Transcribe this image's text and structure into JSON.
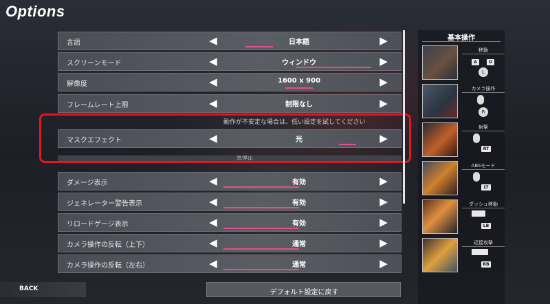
{
  "title": "Options",
  "note": "動作が不安定な場合は、低い設定を試してください",
  "partial_row_text": "急停止",
  "settings": [
    {
      "label": "言語",
      "value": "日本語",
      "level": 0.15
    },
    {
      "label": "スクリーンモード",
      "value": "ウィンドウ",
      "level": 0.7
    },
    {
      "label": "解像度",
      "value": "1600 x 900",
      "level": 0.4
    },
    {
      "label": "フレームレート上限",
      "value": "制限なし",
      "level": 1.0
    },
    {
      "label": "マスクエフェクト",
      "value": "光",
      "level": 0.85
    },
    {
      "label": "ダメージ表示",
      "value": "有効",
      "level": 0.5
    },
    {
      "label": "ジェネレーター警告表示",
      "value": "有効",
      "level": 0.5
    },
    {
      "label": "リロードゲージ表示",
      "value": "有効",
      "level": 0.5
    },
    {
      "label": "カメラ操作の反転（上下）",
      "value": "通常",
      "level": 0.5
    },
    {
      "label": "カメラ操作の反転（左右）",
      "value": "通常",
      "level": 0.5
    }
  ],
  "arrows": {
    "left": "◀",
    "right": "▶"
  },
  "highlight_color": "#e8141f",
  "accent_color": "#e0508a",
  "controls_panel": {
    "title": "基本操作",
    "items": [
      {
        "name": "移動",
        "keys": [
          "A",
          "D"
        ],
        "extra": "L"
      },
      {
        "name": "カメラ操作",
        "keys": [],
        "extra": "R"
      },
      {
        "name": "射撃",
        "keys": [],
        "extra": "RT"
      },
      {
        "name": "ABSモード",
        "keys": [],
        "extra": "LT"
      },
      {
        "name": "ダッシュ移動",
        "keys": [],
        "extra": "LB"
      },
      {
        "name": "近接攻撃",
        "keys": [],
        "extra": "RB"
      }
    ]
  },
  "back_label": "BACK",
  "default_label": "デフォルト設定に戻す"
}
